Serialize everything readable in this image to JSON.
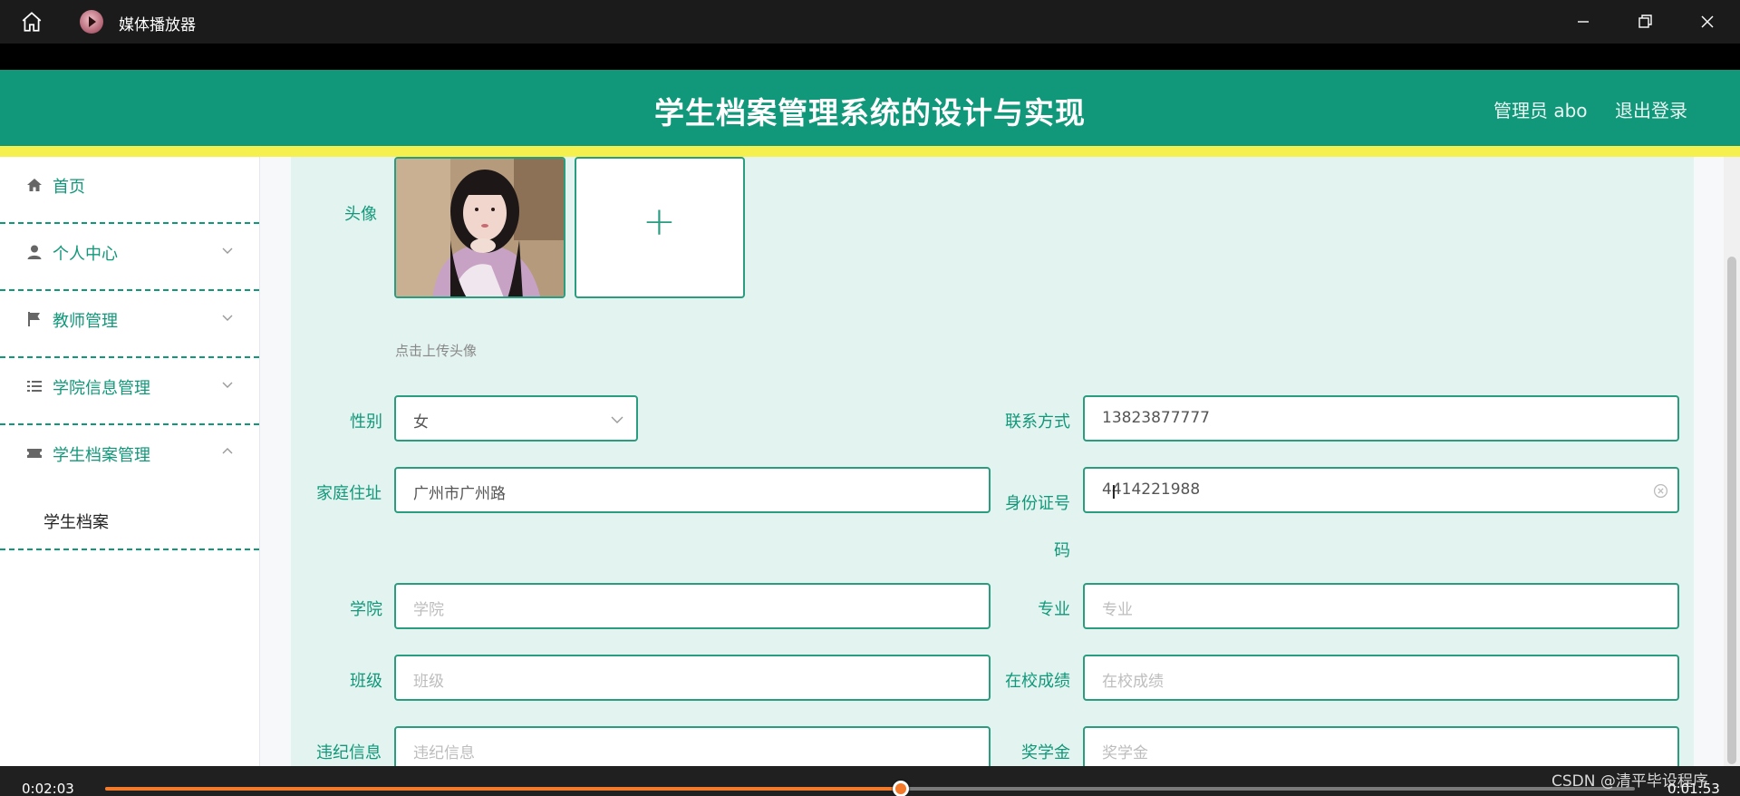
{
  "window": {
    "title": "媒体播放器",
    "icons": {
      "home": "home-icon",
      "app": "media-player-icon",
      "minimize": "minimize-icon",
      "maximize": "maximize-icon",
      "close": "close-icon"
    }
  },
  "header": {
    "title": "学生档案管理系统的设计与实现",
    "user": "管理员 abo",
    "logout": "退出登录",
    "colors": {
      "primary": "#11987a",
      "strip": "#f6f04e"
    }
  },
  "sidebar": {
    "items": [
      {
        "label": "首页",
        "icon": "home-icon",
        "expandable": false
      },
      {
        "label": "个人中心",
        "icon": "user-icon",
        "expandable": true,
        "expanded": false
      },
      {
        "label": "教师管理",
        "icon": "flag-icon",
        "expandable": true,
        "expanded": false
      },
      {
        "label": "学院信息管理",
        "icon": "list-icon",
        "expandable": true,
        "expanded": false
      },
      {
        "label": "学生档案管理",
        "icon": "ticket-icon",
        "expandable": true,
        "expanded": true
      }
    ],
    "subitems": [
      {
        "label": "学生档案"
      }
    ]
  },
  "form": {
    "avatar_label": "头像",
    "upload_hint": "点击上传头像",
    "gender": {
      "label": "性别",
      "value": "女"
    },
    "contact": {
      "label": "联系方式",
      "value": "13823877777"
    },
    "address": {
      "label": "家庭住址",
      "value": "广州市广州路"
    },
    "id_number": {
      "label": "身份证号码",
      "value": "4414221988"
    },
    "college": {
      "label": "学院",
      "placeholder": "学院"
    },
    "major": {
      "label": "专业",
      "placeholder": "专业"
    },
    "class": {
      "label": "班级",
      "placeholder": "班级"
    },
    "grades": {
      "label": "在校成绩",
      "placeholder": "在校成绩"
    },
    "discipline": {
      "label": "违纪信息",
      "placeholder": "违纪信息"
    },
    "scholarship": {
      "label": "奖学金",
      "placeholder": "奖学金"
    }
  },
  "player": {
    "elapsed": "0:02:03",
    "remaining": "0:01:53",
    "progress": 0.52,
    "accent": "#f27a2a"
  },
  "watermark": "CSDN @清平毕设程序"
}
